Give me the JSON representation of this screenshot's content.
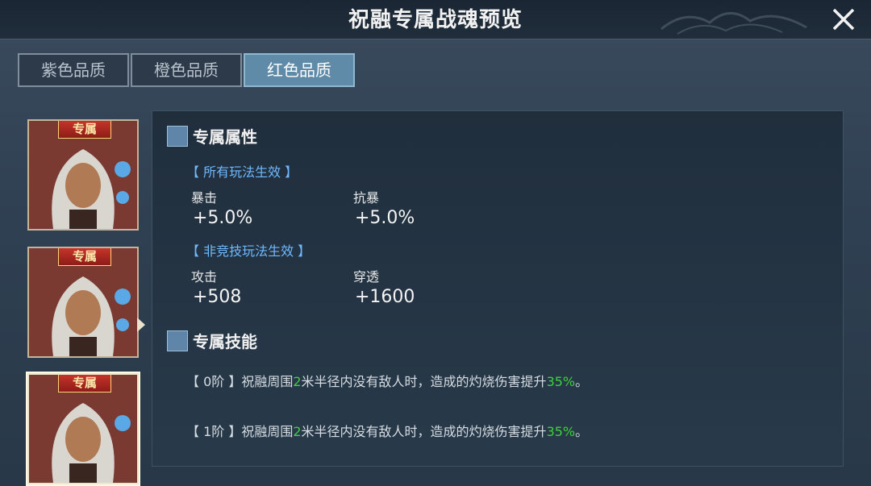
{
  "window": {
    "title": "祝融专属战魂预览",
    "close_icon": "close-icon"
  },
  "tabs": [
    {
      "label": "紫色品质",
      "active": false
    },
    {
      "label": "橙色品质",
      "active": false
    },
    {
      "label": "红色品质",
      "active": true
    }
  ],
  "cards": [
    {
      "badge": "专属",
      "selected": false
    },
    {
      "badge": "专属",
      "selected": false
    },
    {
      "badge": "专属",
      "selected": true
    }
  ],
  "attributes": {
    "heading": "专属属性",
    "groups": [
      {
        "scope": "【 所有玩法生效 】",
        "stats": [
          {
            "name": "暴击",
            "value": "+5.0%"
          },
          {
            "name": "抗暴",
            "value": "+5.0%"
          }
        ]
      },
      {
        "scope": "【 非竞技玩法生效 】",
        "stats": [
          {
            "name": "攻击",
            "value": "+508"
          },
          {
            "name": "穿透",
            "value": "+1600"
          }
        ]
      }
    ]
  },
  "skills": {
    "heading": "专属技能",
    "lines": [
      {
        "prefix": "【 0阶 】祝融周围",
        "hl1": "2",
        "mid": "米半径内没有敌人时，造成的灼烧伤害提升",
        "hl2": "35%",
        "suffix": "。"
      },
      {
        "prefix": "【 1阶 】祝融周围",
        "hl1": "2",
        "mid": "米半径内没有敌人时，造成的灼烧伤害提升",
        "hl2": "35%",
        "suffix": "。"
      }
    ]
  },
  "colors": {
    "accent_blue": "#6fb9ff",
    "highlight_green": "#3fd13f",
    "tab_active": "#5f8aa8"
  }
}
